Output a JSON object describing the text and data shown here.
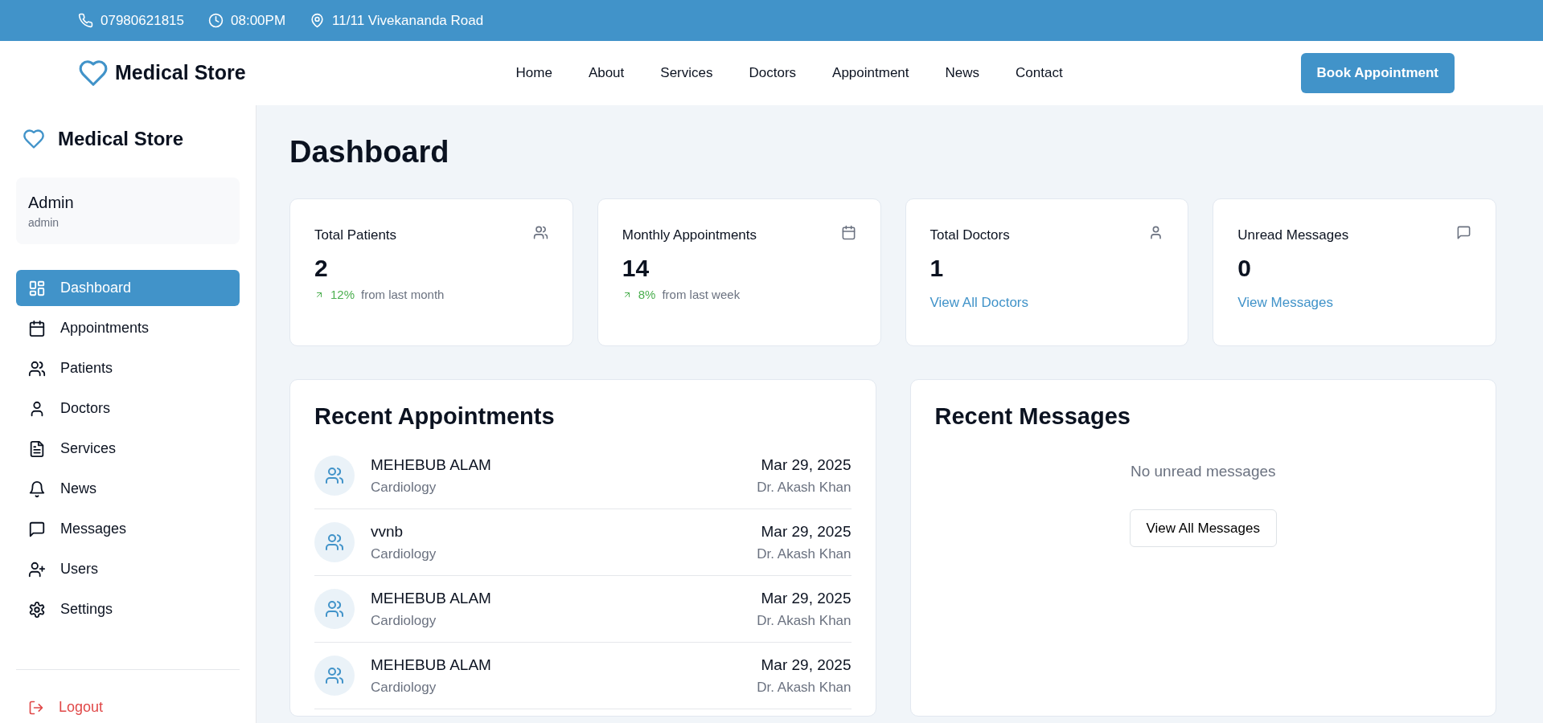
{
  "top_bar": {
    "phone": "07980621815",
    "hours": "08:00PM",
    "address": "11/11 Vivekananda Road"
  },
  "navbar": {
    "brand": "Medical Store",
    "links": [
      "Home",
      "About",
      "Services",
      "Doctors",
      "Appointment",
      "News",
      "Contact"
    ],
    "cta": "Book Appointment"
  },
  "sidebar": {
    "brand": "Medical Store",
    "user": {
      "name": "Admin",
      "role": "admin"
    },
    "items": [
      {
        "label": "Dashboard",
        "selected": true
      },
      {
        "label": "Appointments",
        "selected": false
      },
      {
        "label": "Patients",
        "selected": false
      },
      {
        "label": "Doctors",
        "selected": false
      },
      {
        "label": "Services",
        "selected": false
      },
      {
        "label": "News",
        "selected": false
      },
      {
        "label": "Messages",
        "selected": false
      },
      {
        "label": "Users",
        "selected": false
      },
      {
        "label": "Settings",
        "selected": false
      }
    ],
    "logout": "Logout"
  },
  "page_title": "Dashboard",
  "stats": [
    {
      "kind": "trend",
      "title": "Total Patients",
      "value": "2",
      "trend": "12%",
      "note": "from last month"
    },
    {
      "kind": "trend",
      "title": "Monthly Appointments",
      "value": "14",
      "trend": "8%",
      "note": "from last week"
    },
    {
      "kind": "link",
      "title": "Total Doctors",
      "value": "1",
      "link": "View All Doctors"
    },
    {
      "kind": "link",
      "title": "Unread Messages",
      "value": "0",
      "link": "View Messages"
    }
  ],
  "recent_appointments": {
    "title": "Recent Appointments",
    "rows": [
      {
        "patient": "MEHEBUB ALAM",
        "department": "Cardiology",
        "date": "Mar 29, 2025",
        "doctor": "Dr. Akash Khan"
      },
      {
        "patient": "vvnb",
        "department": "Cardiology",
        "date": "Mar 29, 2025",
        "doctor": "Dr. Akash Khan"
      },
      {
        "patient": "MEHEBUB ALAM",
        "department": "Cardiology",
        "date": "Mar 29, 2025",
        "doctor": "Dr. Akash Khan"
      },
      {
        "patient": "MEHEBUB ALAM",
        "department": "Cardiology",
        "date": "Mar 29, 2025",
        "doctor": "Dr. Akash Khan"
      }
    ]
  },
  "recent_messages": {
    "title": "Recent Messages",
    "empty_text": "No unread messages",
    "button": "View All Messages"
  }
}
